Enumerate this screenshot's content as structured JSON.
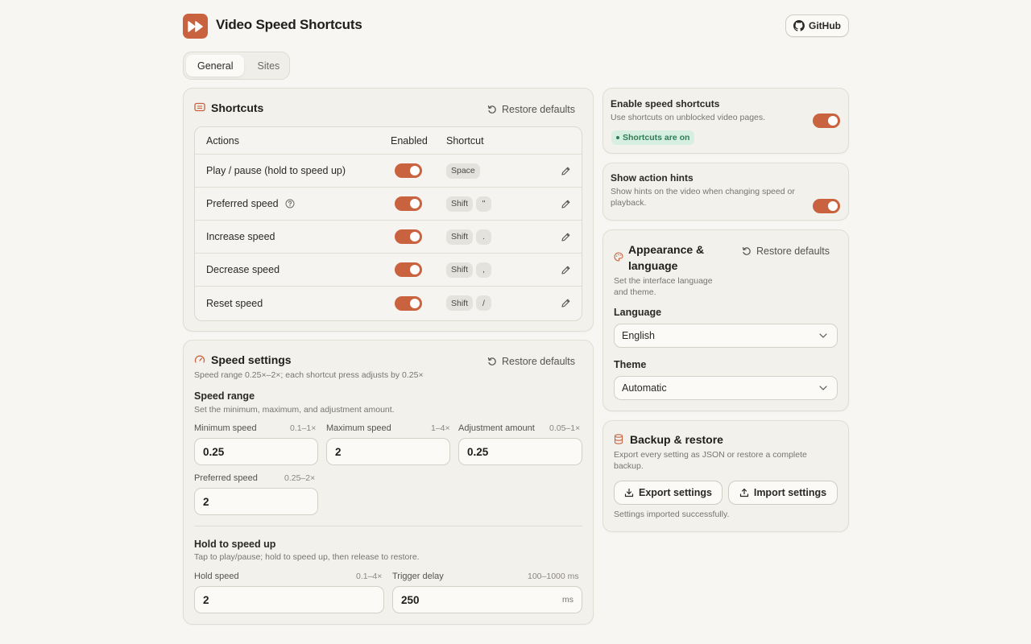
{
  "header": {
    "app_title": "Video Speed Shortcuts",
    "github_label": "GitHub"
  },
  "tabs": [
    {
      "label": "General",
      "active": true
    },
    {
      "label": "Sites",
      "active": false
    }
  ],
  "shortcuts": {
    "title": "Shortcuts",
    "restore_label": "Restore defaults",
    "columns": {
      "actions": "Actions",
      "enabled": "Enabled",
      "shortcut": "Shortcut"
    },
    "rows": [
      {
        "action": "Play / pause (hold to speed up)",
        "enabled": true,
        "keys": [
          "Space"
        ]
      },
      {
        "action": "Preferred speed",
        "enabled": true,
        "keys": [
          "Shift",
          "\""
        ],
        "help": true
      },
      {
        "action": "Increase speed",
        "enabled": true,
        "keys": [
          "Shift",
          "."
        ]
      },
      {
        "action": "Decrease speed",
        "enabled": true,
        "keys": [
          "Shift",
          ","
        ]
      },
      {
        "action": "Reset speed",
        "enabled": true,
        "keys": [
          "Shift",
          "/"
        ]
      }
    ]
  },
  "speed_settings": {
    "title": "Speed settings",
    "restore_label": "Restore defaults",
    "subtitle": "Speed range 0.25×–2×; each shortcut press adjusts by 0.25×",
    "range": {
      "title": "Speed range",
      "description": "Set the minimum, maximum, and adjustment amount.",
      "minimum": {
        "label": "Minimum speed",
        "hint": "0.1–1×",
        "value": "0.25"
      },
      "maximum": {
        "label": "Maximum speed",
        "hint": "1–4×",
        "value": "2"
      },
      "adjustment": {
        "label": "Adjustment amount",
        "hint": "0.05–1×",
        "value": "0.25"
      },
      "preferred": {
        "label": "Preferred speed",
        "hint": "0.25–2×",
        "value": "2"
      }
    },
    "hold": {
      "title": "Hold to speed up",
      "description": "Tap to play/pause; hold to speed up, then release to restore.",
      "hold_speed": {
        "label": "Hold speed",
        "hint": "0.1–4×",
        "value": "2"
      },
      "trigger_delay": {
        "label": "Trigger delay",
        "hint": "100–1000 ms",
        "value": "250",
        "unit": "ms"
      }
    }
  },
  "enable_shortcuts": {
    "title": "Enable speed shortcuts",
    "description": "Use shortcuts on unblocked video pages.",
    "status": "Shortcuts are on",
    "enabled": true
  },
  "action_hints": {
    "title": "Show action hints",
    "description": "Show hints on the video when changing speed or playback.",
    "enabled": true
  },
  "appearance": {
    "title": "Appearance & language",
    "restore_label": "Restore defaults",
    "description": "Set the interface language and theme.",
    "language_label": "Language",
    "language_value": "English",
    "theme_label": "Theme",
    "theme_value": "Automatic"
  },
  "backup": {
    "title": "Backup & restore",
    "description": "Export every setting as JSON or restore a complete backup.",
    "export_label": "Export settings",
    "import_label": "Import settings",
    "status": "Settings imported successfully."
  },
  "colors": {
    "accent": "#c9623f",
    "background": "#f7f6f2",
    "success": "#2e7d55"
  }
}
